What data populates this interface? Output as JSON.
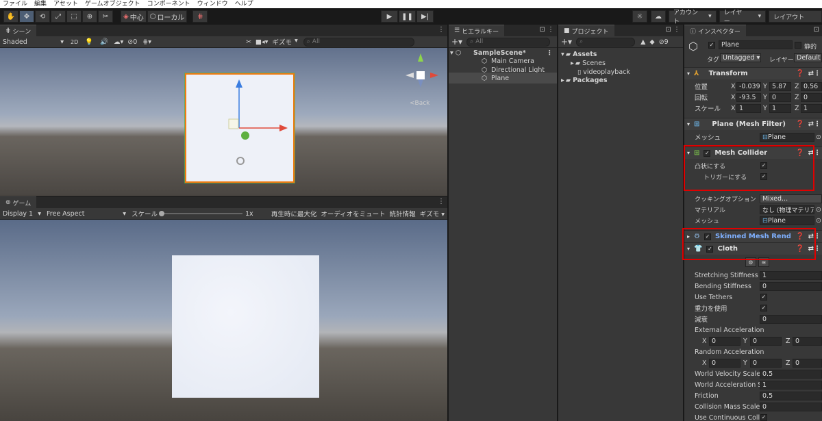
{
  "menu": [
    "ファイル",
    "編集",
    "アセット",
    "ゲームオブジェクト",
    "コンポーネント",
    "ウィンドウ",
    "ヘルプ"
  ],
  "toolbar": {
    "pivot": "中心",
    "space": "ローカル",
    "account": "アカウント",
    "layers": "レイヤー",
    "layout": "レイアウト"
  },
  "scene": {
    "tab": "シーン",
    "shading": "Shaded",
    "mode2d": "2D",
    "hidden_count": "0",
    "gizmos": "ギズモ",
    "search_placeholder": "All",
    "back_label": "<Back"
  },
  "game": {
    "tab": "ゲーム",
    "display": "Display 1",
    "aspect": "Free Aspect",
    "scale_label": "スケール",
    "scale_value": "1x",
    "maximize": "再生時に最大化",
    "mute": "オーディオをミュート",
    "stats": "統計情報",
    "gizmos": "ギズモ"
  },
  "hierarchy": {
    "tab": "ヒエラルキー",
    "search_placeholder": "All",
    "scene": "SampleScene*",
    "items": [
      "Main Camera",
      "Directional Light",
      "Plane"
    ]
  },
  "project": {
    "tab": "プロジェクト",
    "hidden_count": "9",
    "assets": "Assets",
    "scenes": "Scenes",
    "video": "videoplayback",
    "packages": "Packages"
  },
  "inspector": {
    "tab": "インスペクター",
    "object_name": "Plane",
    "static_label": "静的",
    "tag_label": "タグ",
    "tag_value": "Untagged",
    "layer_label": "レイヤー",
    "layer_value": "Default",
    "transform": {
      "title": "Transform",
      "position_label": "位置",
      "rotation_label": "回転",
      "scale_label": "スケール",
      "position": {
        "x": "-0.039",
        "y": "5.87",
        "z": "0.56"
      },
      "rotation": {
        "x": "-93.5",
        "y": "0",
        "z": "0"
      },
      "scale": {
        "x": "1",
        "y": "1",
        "z": "1"
      }
    },
    "mesh_filter": {
      "title": "Plane (Mesh Filter)",
      "mesh_label": "メッシュ",
      "mesh_value": "Plane"
    },
    "mesh_collider": {
      "title": "Mesh Collider",
      "convex_label": "凸状にする",
      "trigger_label": "トリガーにする",
      "cooking_label": "クッキングオプション",
      "cooking_value": "Mixed...",
      "material_label": "マテリアル",
      "material_value": "なし (物理マテリアル)",
      "mesh_label": "メッシュ",
      "mesh_value": "Plane"
    },
    "skinned": {
      "title": "Skinned Mesh Renderer"
    },
    "cloth": {
      "title": "Cloth",
      "props": [
        {
          "label": "Stretching Stiffness",
          "value": "1",
          "type": "field"
        },
        {
          "label": "Bending Stiffness",
          "value": "0",
          "type": "field"
        },
        {
          "label": "Use Tethers",
          "value": "",
          "type": "check"
        },
        {
          "label": "重力を使用",
          "value": "",
          "type": "check"
        },
        {
          "label": "減衰",
          "value": "0",
          "type": "field"
        }
      ],
      "ext_accel_label": "External Acceleration",
      "ext_accel": {
        "x": "0",
        "y": "0",
        "z": "0"
      },
      "rand_accel_label": "Random Acceleration",
      "rand_accel": {
        "x": "0",
        "y": "0",
        "z": "0"
      },
      "props2": [
        {
          "label": "World Velocity Scale",
          "value": "0.5",
          "type": "field"
        },
        {
          "label": "World Acceleration Scale",
          "value": "1",
          "type": "field"
        },
        {
          "label": "Friction",
          "value": "0.5",
          "type": "field"
        },
        {
          "label": "Collision Mass Scale",
          "value": "0",
          "type": "field"
        },
        {
          "label": "Use Continuous Collision",
          "value": "",
          "type": "check"
        }
      ]
    }
  }
}
